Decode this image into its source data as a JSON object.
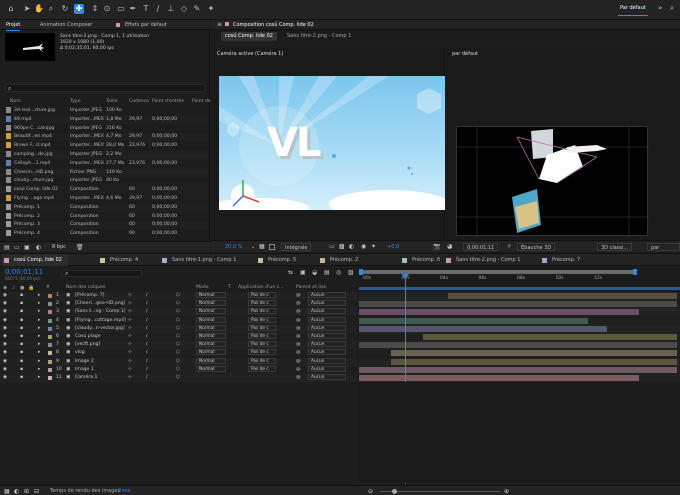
{
  "toolbar": {
    "workspace": "Par défaut"
  },
  "project_panel": {
    "tabs": [
      "Projet",
      "Animation Composer",
      "Effets par défaut"
    ],
    "preview": {
      "name": "Sans titre-2.png - Comp 1",
      "usage": ", 1 utilisation",
      "size": "1920 x 1080 (1,00)",
      "duration": "Δ 0;02;35;01, 60,00 ips"
    },
    "columns": [
      "Nom",
      "Type",
      "Taille",
      "Cadence",
      "Point d'entrée",
      "Point de"
    ],
    "items": [
      {
        "name": "3d-real...cture.jpg",
        "type": "Importer JPEG",
        "size": "100 Ko",
        "rate": "",
        "in": "",
        "icon": "#8a8a8a"
      },
      {
        "name": "49.mp4",
        "type": "Importer...MEX",
        "size": "1,8 Mo",
        "rate": "29,97",
        "in": "0;00;00;00",
        "icon": "#5a7fb0"
      },
      {
        "name": "960px-C...cainjpg",
        "type": "Importer JPEG",
        "size": "316 Ko",
        "rate": "",
        "in": "",
        "icon": "#8a8a8a"
      },
      {
        "name": "Beautif...en.mp4",
        "type": "Importer...MEX",
        "size": "4,7 Mo",
        "rate": "29,97",
        "in": "0;00;00;00",
        "icon": "#d49b3a"
      },
      {
        "name": "Brown F...d.mp4",
        "type": "Importer...MEX",
        "size": "28,0 Mo",
        "rate": "23,976",
        "in": "0;00;00;00",
        "icon": "#d49b3a"
      },
      {
        "name": "camping...de.jpg",
        "type": "Importer JPEG",
        "size": "2,2 Mo",
        "rate": "",
        "in": "",
        "icon": "#8a8a8a"
      },
      {
        "name": "Celloph...1.mp4",
        "type": "Importer...MEX",
        "size": "27,7 Mo",
        "rate": "23,976",
        "in": "0;00;00;00",
        "icon": "#5a7fb0"
      },
      {
        "name": "Cheerin...HD.png",
        "type": "Fichier PNG",
        "size": "149 Ko",
        "rate": "",
        "in": "",
        "icon": "#8a8a8a"
      },
      {
        "name": "cloudy...cture.jpg",
        "type": "Importer JPEG",
        "size": "40 Ko",
        "rate": "",
        "in": "",
        "icon": "#8a8a8a"
      },
      {
        "name": "cosú Comp. lide 02",
        "type": "Composition",
        "size": "",
        "rate": "60",
        "in": "0;00;00;00",
        "icon": "#9a9a9a"
      },
      {
        "name": "Flying ...age.mp4",
        "type": "Importer...MEX",
        "size": "4,6 Mo",
        "rate": "29,97",
        "in": "0;00;00;00",
        "icon": "#d49b3a"
      },
      {
        "name": "Précomp. 1",
        "type": "Composition",
        "size": "",
        "rate": "60",
        "in": "0;00;00;00",
        "icon": "#9a9a9a"
      },
      {
        "name": "Précomp. 2",
        "type": "Composition",
        "size": "",
        "rate": "60",
        "in": "0;00;00;00",
        "icon": "#9a9a9a"
      },
      {
        "name": "Précomp. 3",
        "type": "Composition",
        "size": "",
        "rate": "60",
        "in": "0;00;00;00",
        "icon": "#9a9a9a"
      },
      {
        "name": "Précomp. 4",
        "type": "Composition",
        "size": "",
        "rate": "60",
        "in": "0;00;00;00",
        "icon": "#9a9a9a"
      }
    ],
    "footer": {
      "bpc": "8 bpc"
    }
  },
  "composition_panel": {
    "header": "Composition cosú Comp. lide 02",
    "tabs": [
      "cosú Comp. lide 02",
      "Sans titre-2.png - Comp 1"
    ],
    "view_left": "Caméra active (Caméra 1)",
    "view_right": "par défaut",
    "preview_text": "VL",
    "footer": {
      "zoom": "20,0 %",
      "quality": "Intégrale",
      "exposure": "+0,0",
      "timecode": "0;00:01:11",
      "renderer": "Ébauche 3D",
      "view_3d": "3D classi...",
      "view_default": "par défaut"
    }
  },
  "timeline": {
    "tabs": [
      "cosú Comp. lide 02",
      "Précomp. 4",
      "Sans titre-1.png - Comp 1",
      "Précomp. 5",
      "Précomp. 2",
      "Précomp. 6",
      "Sans titre-2.png - Comp 1",
      "Précomp. 7"
    ],
    "timecode": "0;00;01;11",
    "timecode_sub": "00071 (60,00 ips)",
    "search_placeholder": "",
    "columns": {
      "num": "#",
      "name": "Nom des calques",
      "mode": "Mode",
      "t": "T",
      "track": "Application d'un c...",
      "parent": "Parent et lien"
    },
    "ruler": [
      "00s",
      "02s",
      "04s",
      "06s",
      "08s",
      "10s",
      "12s"
    ],
    "layers": [
      {
        "num": "1",
        "name": "[Précomp. 7]",
        "mode": "Normal",
        "track": "Pas de c",
        "parent": "Aucun",
        "color": "#a38a74",
        "start": 0.28,
        "end": 1.0,
        "bar": "#5d4d40"
      },
      {
        "num": "2",
        "name": "[Cheeri...geo-HD.png]",
        "mode": "Normal",
        "track": "Pas de c",
        "parent": "Aucun",
        "color": "#8a8a8a",
        "start": 0.0,
        "end": 1.0,
        "bar": "#4a4a4a"
      },
      {
        "num": "3",
        "name": "[Sans t...ng - Comp 1]",
        "mode": "Normal",
        "track": "Pas de c",
        "parent": "Aucun",
        "color": "#b07f9a",
        "start": 0.0,
        "end": 0.88,
        "bar": "#6a4f64"
      },
      {
        "num": "4",
        "name": "[Flying...cottage.mp4]",
        "mode": "Normal",
        "track": "Pas de c",
        "parent": "Aucun",
        "color": "#6d9a86",
        "start": 0.0,
        "end": 0.72,
        "bar": "#3f5a4e"
      },
      {
        "num": "5",
        "name": "[cloudy...n-vector.jpg]",
        "mode": "Normal",
        "track": "Pas de c",
        "parent": "Aucun",
        "color": "#7d7faa",
        "start": 0.0,
        "end": 0.78,
        "bar": "#55576f"
      },
      {
        "num": "6",
        "name": "Cosú plage",
        "mode": "Normal",
        "track": "Pas de c",
        "parent": "Aucun",
        "color": "#a7a35e",
        "start": 0.2,
        "end": 1.0,
        "bar": "#5c5a3c"
      },
      {
        "num": "7",
        "name": "[vecft.png]",
        "mode": "Normal",
        "track": "Pas de c",
        "parent": "Aucun",
        "color": "#8a8a8a",
        "start": 0.0,
        "end": 1.0,
        "bar": "#4a4a4a"
      },
      {
        "num": "8",
        "name": "vlog",
        "mode": "Normal",
        "track": "Pas de c",
        "parent": "Aucun",
        "color": "#c8b89a",
        "start": 0.1,
        "end": 1.0,
        "bar": "#6b6150"
      },
      {
        "num": "9",
        "name": "Image 2",
        "mode": "Normal",
        "track": "Pas de c",
        "parent": "Aucun",
        "color": "#b5a27c",
        "start": 0.1,
        "end": 1.0,
        "bar": "#5d5440"
      },
      {
        "num": "10",
        "name": "Image 1",
        "mode": "Normal",
        "track": "Pas de c",
        "parent": "Aucun",
        "color": "#b89aa6",
        "start": 0.0,
        "end": 1.0,
        "bar": "#6f5a63"
      },
      {
        "num": "11",
        "name": "Caméra 1",
        "mode": "",
        "track": "",
        "parent": "Aucun",
        "color": "#d4aab0",
        "start": 0.0,
        "end": 0.88,
        "bar": "#7a5c61"
      }
    ],
    "footer": {
      "render_time_label": "Temps de rendu des images :",
      "render_time": "0 ms"
    }
  },
  "colors": {
    "accent": "#2d8ceb",
    "panel": "#1d1d1d",
    "header": "#232323"
  }
}
